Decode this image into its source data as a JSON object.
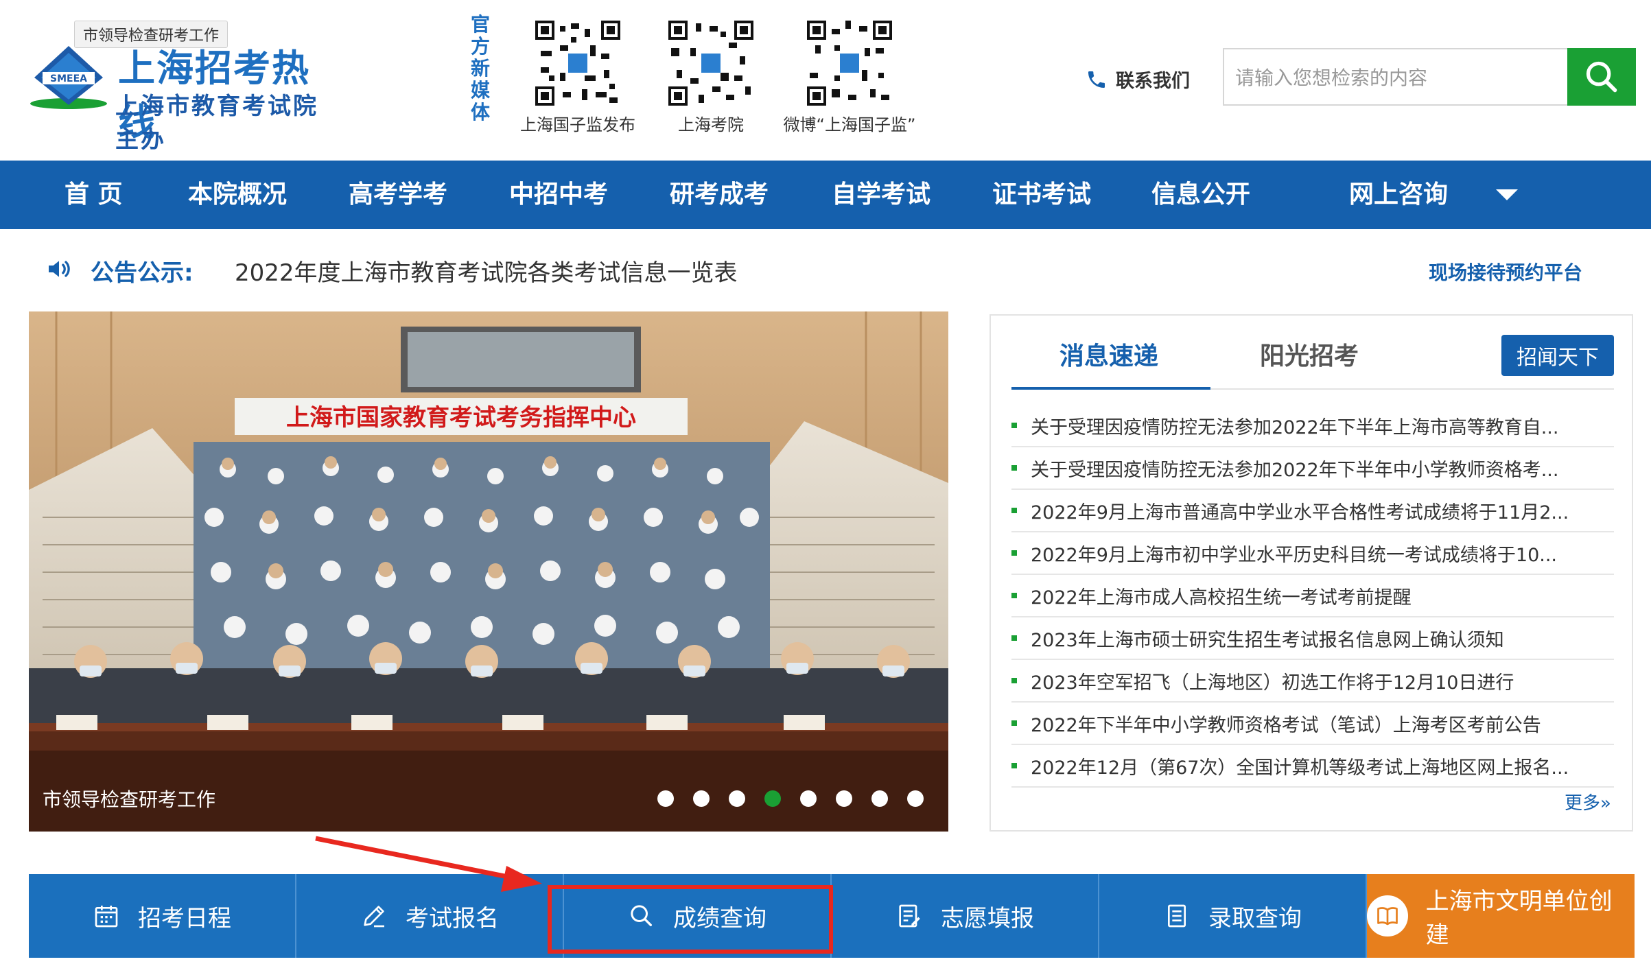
{
  "header": {
    "logo_title": "上海招考热线",
    "logo_sub": "上海市教育考试院主办",
    "logo_badge": "SMEEA",
    "tooltip": "市领导检查研考工作",
    "media_label": "官方新媒体",
    "qr_codes": [
      {
        "caption": "上海国子监发布"
      },
      {
        "caption": "上海考院"
      },
      {
        "caption": "微博“上海国子监”"
      }
    ],
    "contact_label": "联系我们",
    "search_placeholder": "请输入您想检索的内容"
  },
  "nav": {
    "items": [
      "首 页",
      "本院概况",
      "高考学考",
      "中招中考",
      "研考成考",
      "自学考试",
      "证书考试",
      "信息公开",
      "网上咨询"
    ]
  },
  "notice": {
    "label": "公告公示:",
    "text": "2022年度上海市教育考试院各类考试信息一览表",
    "link": "现场接待预约平台"
  },
  "slider": {
    "banner_text": "上海市国家教育考试考务指挥中心",
    "caption": "市领导检查研考工作",
    "dot_count": 8,
    "active_index": 3
  },
  "news": {
    "tabs": [
      "消息速递",
      "阳光招考"
    ],
    "button": "招闻天下",
    "items": [
      "关于受理因疫情防控无法参加2022年下半年上海市高等教育自...",
      "关于受理因疫情防控无法参加2022年下半年中小学教师资格考...",
      "2022年9月上海市普通高中学业水平合格性考试成绩将于11月2...",
      "2022年9月上海市初中学业水平历史科目统一考试成绩将于10...",
      "2022年上海市成人高校招生统一考试考前提醒",
      "2023年上海市硕士研究生招生考试报名信息网上确认须知",
      "2023年空军招飞（上海地区）初选工作将于12月10日进行",
      "2022年下半年中小学教师资格考试（笔试）上海考区考前公告",
      "2022年12月（第67次）全国计算机等级考试上海地区网上报名..."
    ],
    "more": "更多»"
  },
  "quickbar": {
    "items": [
      {
        "label": "招考日程",
        "icon": "calendar-icon"
      },
      {
        "label": "考试报名",
        "icon": "pencil-icon"
      },
      {
        "label": "成绩查询",
        "icon": "search-icon"
      },
      {
        "label": "志愿填报",
        "icon": "form-icon"
      },
      {
        "label": "录取查询",
        "icon": "document-icon"
      },
      {
        "label": "上海市文明单位创建",
        "icon": "book-icon"
      }
    ]
  },
  "colors": {
    "brand_blue": "#1560ad",
    "green": "#1aa034",
    "orange": "#e77f1d",
    "annotation_red": "#e8281f"
  }
}
